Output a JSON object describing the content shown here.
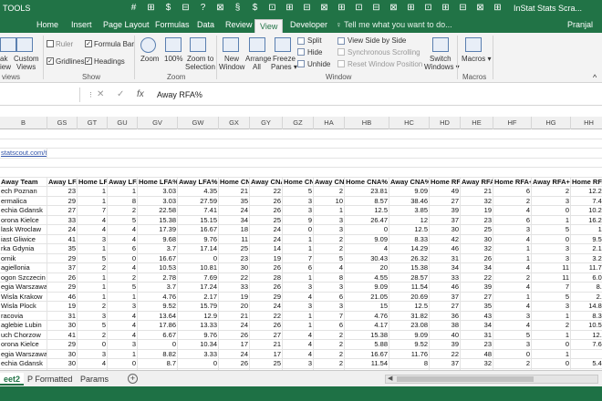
{
  "window": {
    "qat_icons": [
      "#",
      "⊞",
      "$",
      "⊟",
      "?",
      "⊠",
      "§",
      "$",
      "⊡",
      "⊞",
      "⊟",
      "⊠",
      "⊞",
      "⊡",
      "⊟",
      "⊠",
      "⊞",
      "⊡",
      "⊞",
      "⊟",
      "⊠",
      "⊞"
    ],
    "left_label": "TOOLS",
    "title": "InStat Stats Scra...",
    "user": "Pranjal"
  },
  "ribbon_tabs": [
    {
      "label": "Home"
    },
    {
      "label": "Insert"
    },
    {
      "label": "Page Layout"
    },
    {
      "label": "Formulas"
    },
    {
      "label": "Data"
    },
    {
      "label": "Review"
    },
    {
      "label": "View",
      "active": true
    },
    {
      "label": "Developer"
    }
  ],
  "tell_me": "Tell me what you want to do...",
  "ribbon": {
    "workbook_views": {
      "page_break": "ak",
      "page_break2": "iew",
      "custom": "Custom",
      "custom2": "Views",
      "group": "views"
    },
    "show": {
      "ruler": "Ruler",
      "formula_bar": "Formula Bar",
      "gridlines": "Gridlines",
      "headings": "Headings",
      "group": "Show",
      "ruler_checked": false,
      "formula_bar_checked": true,
      "gridlines_checked": true,
      "headings_checked": true
    },
    "zoom": {
      "zoom": "Zoom",
      "zoom100": "100%",
      "zoom_sel1": "Zoom to",
      "zoom_sel2": "Selection",
      "group": "Zoom"
    },
    "window": {
      "new1": "New",
      "new2": "Window",
      "arrange1": "Arrange",
      "arrange2": "All",
      "freeze1": "Freeze",
      "freeze2": "Panes",
      "split": "Split",
      "hide": "Hide",
      "unhide": "Unhide",
      "side": "View Side by Side",
      "sync": "Synchronous Scrolling",
      "reset": "Reset Window Position",
      "switch1": "Switch",
      "switch2": "Windows",
      "group": "Window"
    },
    "macros": {
      "label": "Macros",
      "group": "Macros"
    }
  },
  "formula_bar": {
    "cancel": "✕",
    "enter": "✓",
    "fx": "fx",
    "content": "Away RFA%"
  },
  "columns": [
    "B",
    "GS",
    "GT",
    "GU",
    "GV",
    "GW",
    "GX",
    "GY",
    "GZ",
    "HA",
    "HB",
    "HC",
    "HD",
    "HE",
    "HF",
    "HG",
    "HH"
  ],
  "link_text": "statscout.com/tou",
  "headers": [
    "Away Team",
    "Away LFA",
    "Home LFA+",
    "Away LFA+",
    "Home LFA%",
    "Away LFA%",
    "Home CNA",
    "Away CNA",
    "Home CNA+",
    "Away CNA+",
    "Home CNA%",
    "Away CNA%",
    "Home RFA",
    "Away RFA",
    "Home RFA+",
    "Away RFA+",
    "Home RFA%"
  ],
  "rows": [
    [
      "ech Poznan",
      "23",
      "1",
      "1",
      "3.03",
      "4.35",
      "21",
      "22",
      "5",
      "2",
      "23.81",
      "9.09",
      "49",
      "21",
      "6",
      "2",
      "12.24"
    ],
    [
      "ermalica",
      "29",
      "1",
      "8",
      "3.03",
      "27.59",
      "35",
      "26",
      "3",
      "10",
      "8.57",
      "38.46",
      "27",
      "32",
      "2",
      "3",
      "7.41"
    ],
    [
      "echia Gdansk",
      "27",
      "7",
      "2",
      "22.58",
      "7.41",
      "24",
      "26",
      "3",
      "1",
      "12.5",
      "3.85",
      "39",
      "19",
      "4",
      "0",
      "10.26"
    ],
    [
      "orona Kielce",
      "33",
      "4",
      "5",
      "15.38",
      "15.15",
      "34",
      "25",
      "9",
      "3",
      "26.47",
      "12",
      "37",
      "23",
      "6",
      "1",
      "16.22"
    ],
    [
      "lask Wroclaw",
      "24",
      "4",
      "4",
      "17.39",
      "16.67",
      "18",
      "24",
      "0",
      "3",
      "0",
      "12.5",
      "30",
      "25",
      "3",
      "5",
      "10"
    ],
    [
      "iast Gliwice",
      "41",
      "3",
      "4",
      "9.68",
      "9.76",
      "11",
      "24",
      "1",
      "2",
      "9.09",
      "8.33",
      "42",
      "30",
      "4",
      "0",
      "9.52"
    ],
    [
      "rka Gdynia",
      "35",
      "1",
      "6",
      "3.7",
      "17.14",
      "25",
      "14",
      "1",
      "2",
      "4",
      "14.29",
      "46",
      "32",
      "1",
      "3",
      "2.17"
    ],
    [
      "ornik",
      "29",
      "5",
      "0",
      "16.67",
      "0",
      "23",
      "19",
      "7",
      "5",
      "30.43",
      "26.32",
      "31",
      "26",
      "1",
      "3",
      "3.23"
    ],
    [
      "agiellonia",
      "37",
      "2",
      "4",
      "10.53",
      "10.81",
      "30",
      "26",
      "6",
      "4",
      "20",
      "15.38",
      "34",
      "34",
      "4",
      "11",
      "11.76"
    ],
    [
      "ogon Szczecin",
      "26",
      "1",
      "2",
      "2.78",
      "7.69",
      "22",
      "28",
      "1",
      "8",
      "4.55",
      "28.57",
      "33",
      "22",
      "2",
      "11",
      "6.06"
    ],
    [
      "egia Warszawa",
      "29",
      "1",
      "5",
      "3.7",
      "17.24",
      "33",
      "26",
      "3",
      "3",
      "9.09",
      "11.54",
      "46",
      "39",
      "4",
      "7",
      "8.7"
    ],
    [
      "Wisla Krakow",
      "46",
      "1",
      "1",
      "4.76",
      "2.17",
      "19",
      "29",
      "4",
      "6",
      "21.05",
      "20.69",
      "37",
      "27",
      "1",
      "5",
      "2.7"
    ],
    [
      "Wisla Plock",
      "19",
      "2",
      "3",
      "9.52",
      "15.79",
      "20",
      "24",
      "3",
      "3",
      "15",
      "12.5",
      "27",
      "35",
      "4",
      "3",
      "14.81"
    ],
    [
      "racovia",
      "31",
      "3",
      "4",
      "13.64",
      "12.9",
      "21",
      "22",
      "1",
      "7",
      "4.76",
      "31.82",
      "36",
      "43",
      "3",
      "1",
      "8.33"
    ],
    [
      "aglebie Lubin",
      "30",
      "5",
      "4",
      "17.86",
      "13.33",
      "24",
      "26",
      "1",
      "6",
      "4.17",
      "23.08",
      "38",
      "34",
      "4",
      "2",
      "10.53"
    ],
    [
      "uch Chorzow",
      "41",
      "2",
      "4",
      "6.67",
      "9.76",
      "26",
      "27",
      "4",
      "2",
      "15.38",
      "9.09",
      "40",
      "31",
      "5",
      "1",
      "12.5"
    ],
    [
      "orona Kielce",
      "29",
      "0",
      "3",
      "0",
      "10.34",
      "17",
      "21",
      "4",
      "2",
      "5.88",
      "9.52",
      "39",
      "23",
      "3",
      "0",
      "7.69"
    ],
    [
      "egia Warszawa",
      "30",
      "3",
      "1",
      "8.82",
      "3.33",
      "24",
      "17",
      "4",
      "2",
      "16.67",
      "11.76",
      "22",
      "48",
      "0",
      "1",
      "0"
    ],
    [
      "echia Gdansk",
      "30",
      "4",
      "0",
      "8.7",
      "0",
      "26",
      "25",
      "3",
      "2",
      "11.54",
      "8",
      "37",
      "32",
      "2",
      "0",
      "5.41"
    ],
    [
      "ogon Szczecin",
      "23",
      "4",
      "4",
      "12.5",
      "17.39",
      "18",
      "33",
      "2",
      "3",
      "13.33",
      "24.32",
      "29",
      "23",
      "3",
      "2",
      "10.34"
    ],
    [
      "aglebie Lubin",
      "27",
      "1",
      "2",
      "3.57",
      "7.41",
      "18",
      "21",
      "2",
      "4",
      "11.11",
      "19.05",
      "28",
      "35",
      "2",
      "2",
      "7.14"
    ]
  ],
  "sheets": [
    {
      "label": "eet2",
      "active": true
    },
    {
      "label": "P Formatted"
    },
    {
      "label": "Params"
    }
  ],
  "add_sheet": "+",
  "scroll_left": "◀"
}
